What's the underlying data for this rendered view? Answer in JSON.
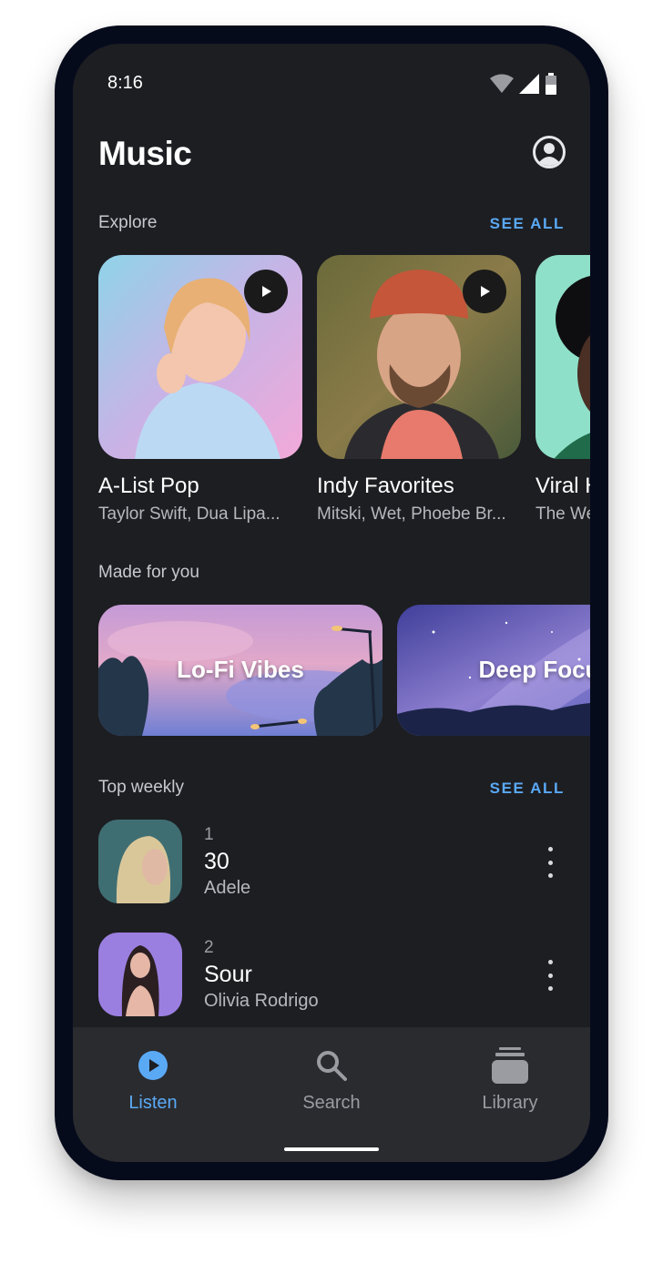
{
  "status_bar": {
    "time": "8:16"
  },
  "header": {
    "title": "Music"
  },
  "explore": {
    "label": "Explore",
    "see_all": "SEE ALL",
    "cards": [
      {
        "title": "A-List Pop",
        "subtitle": "Taylor Swift, Dua Lipa..."
      },
      {
        "title": "Indy Favorites",
        "subtitle": "Mitski, Wet, Phoebe Br..."
      },
      {
        "title": "Viral H",
        "subtitle": "The We"
      }
    ]
  },
  "made_for_you": {
    "label": "Made for you",
    "mixes": [
      {
        "title": "Lo-Fi Vibes"
      },
      {
        "title": "Deep Focu"
      }
    ]
  },
  "top_weekly": {
    "label": "Top weekly",
    "see_all": "SEE ALL",
    "tracks": [
      {
        "rank": "1",
        "title": "30",
        "artist": "Adele"
      },
      {
        "rank": "2",
        "title": "Sour",
        "artist": "Olivia Rodrigo"
      }
    ]
  },
  "bottom_nav": {
    "items": [
      {
        "label": "Listen",
        "icon": "play-circle-icon",
        "active": true
      },
      {
        "label": "Search",
        "icon": "search-icon",
        "active": false
      },
      {
        "label": "Library",
        "icon": "library-icon",
        "active": false
      }
    ]
  },
  "colors": {
    "accent": "#5aa9f5",
    "background": "#1d1e22",
    "nav_background": "#2a2b2f",
    "frame": "#060b1c"
  }
}
